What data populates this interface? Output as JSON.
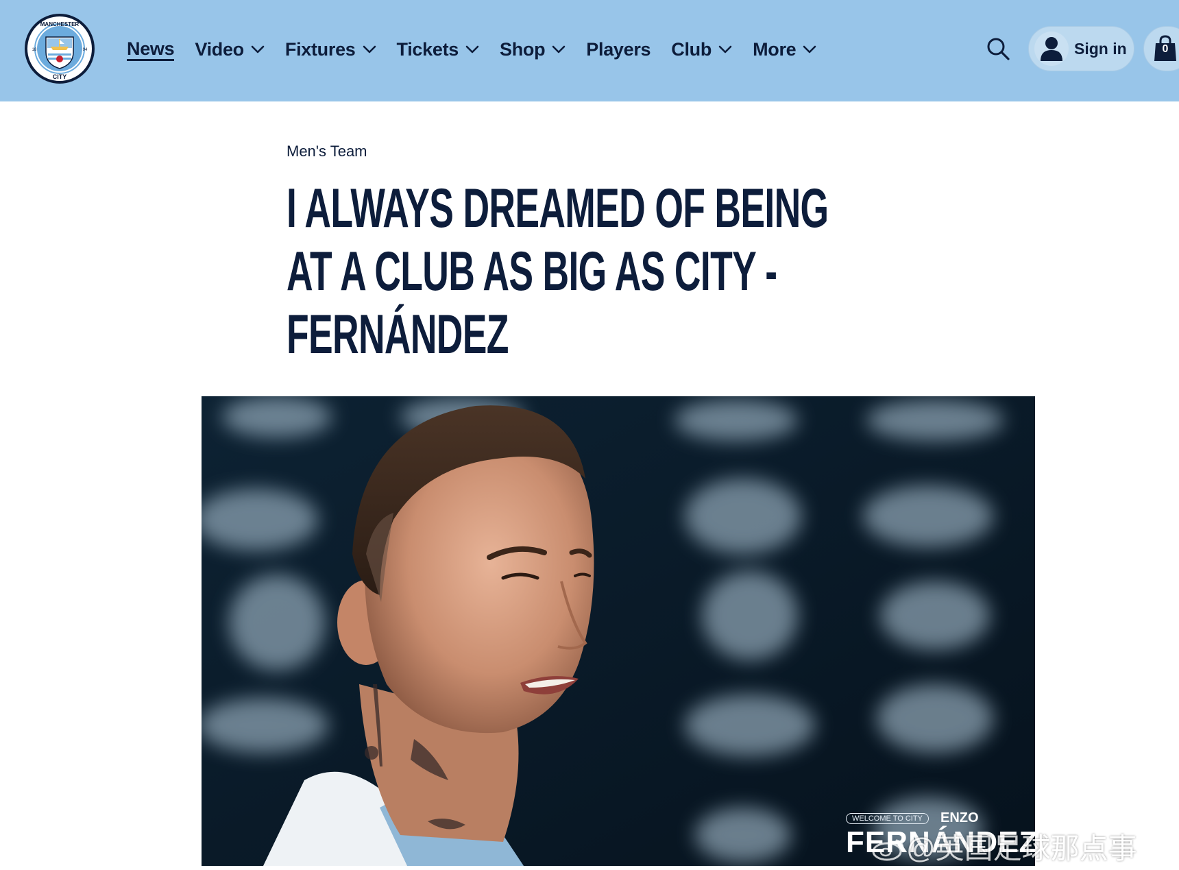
{
  "header": {
    "crest": {
      "ring_text_top": "MANCHESTER",
      "ring_text_bottom": "CITY",
      "year_left": "18",
      "year_right": "94"
    },
    "nav": [
      {
        "label": "News",
        "active": true,
        "dropdown": false
      },
      {
        "label": "Video",
        "active": false,
        "dropdown": true
      },
      {
        "label": "Fixtures",
        "active": false,
        "dropdown": true
      },
      {
        "label": "Tickets",
        "active": false,
        "dropdown": true
      },
      {
        "label": "Shop",
        "active": false,
        "dropdown": true
      },
      {
        "label": "Players",
        "active": false,
        "dropdown": false
      },
      {
        "label": "Club",
        "active": false,
        "dropdown": true
      },
      {
        "label": "More",
        "active": false,
        "dropdown": true
      }
    ],
    "signin_label": "Sign in",
    "cart_count": "0",
    "icons": {
      "search": "search-icon",
      "user": "user-icon",
      "cart": "shopping-bag-icon",
      "dropdown": "chevron-down-icon"
    }
  },
  "article": {
    "category": "Men's Team",
    "headline_lines": [
      "I ALWAYS DREAMED OF BEING",
      "AT A CLUB AS BIG AS CITY -",
      "FERNÁNDEZ"
    ],
    "hero_overlay": {
      "welcome": "WELCOME TO CITY",
      "first_name": "ENZO",
      "last_name": "FERNÁNDEZ"
    }
  },
  "watermark": "@英国足球那点事",
  "colors": {
    "header_bg": "#98c5e9",
    "navy": "#0d1d3b",
    "page_bg": "#ffffff",
    "hero_bg": "#0a1a29"
  }
}
